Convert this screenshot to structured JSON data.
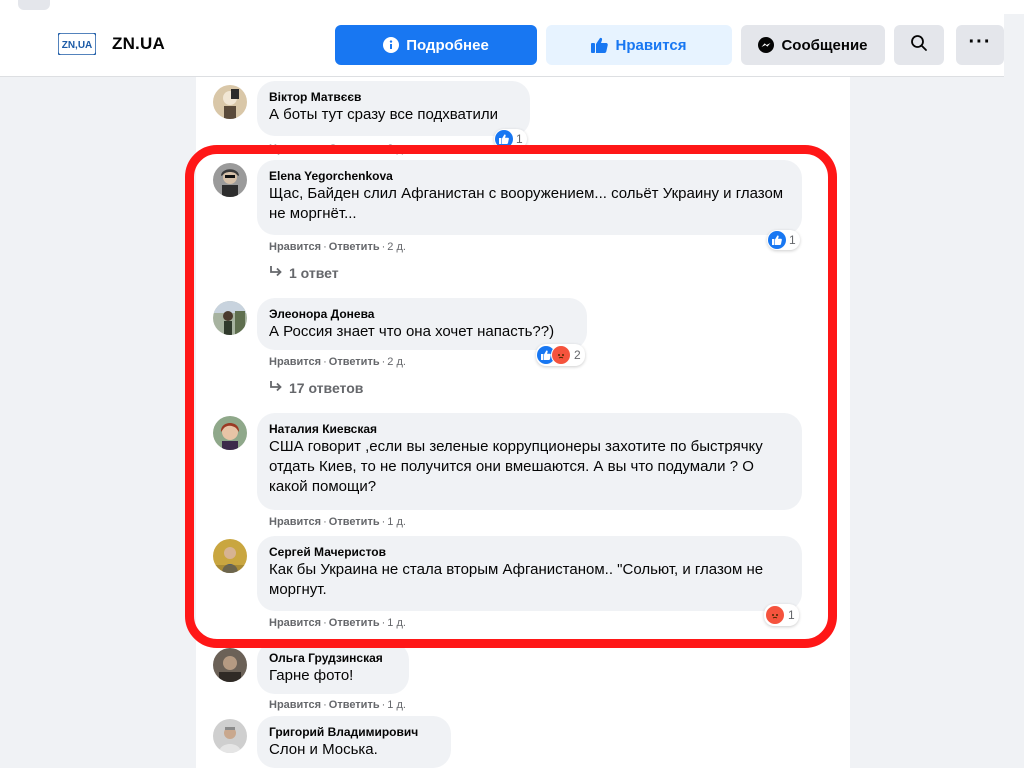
{
  "header": {
    "page_logo_text": "ZN,UA",
    "page_name": "ZN.UA",
    "buttons": {
      "more": "Подробнее",
      "like": "Нравится",
      "message": "Сообщение",
      "dots": "···"
    }
  },
  "comments": [
    {
      "author": "Віктор Матвєєв",
      "text": "А боты тут сразу все подхватили",
      "like_label": "Нравится",
      "reply_label": "Ответить",
      "time": "2 д.",
      "reactions_count": "1"
    },
    {
      "author": "Elena Yegorchenkova",
      "text": "Щас, Байден слил Афганистан с вооружением... сольёт Украину и глазом не моргнёт...",
      "like_label": "Нравится",
      "reply_label": "Ответить",
      "time": "2 д.",
      "reactions_count": "1",
      "replies_label": "1 ответ"
    },
    {
      "author": "Элеонора Донева",
      "text": "А Россия знает что она хочет напасть??)",
      "like_label": "Нравится",
      "reply_label": "Ответить",
      "time": "2 д.",
      "reactions_count": "2",
      "replies_label": "17 ответов"
    },
    {
      "author": "Наталия Киевская",
      "text": "США говорит ,если вы зеленые коррупционеры захотите по быстрячку отдать Киев, то не получится они вмешаются. А вы что подумали ? О какой помощи?",
      "like_label": "Нравится",
      "reply_label": "Ответить",
      "time": "1 д."
    },
    {
      "author": "Сергей Мачеристов",
      "text": "Как бы Украина не стала вторым Афганистаном.. \"Сольют, и глазом не моргнут.",
      "like_label": "Нравится",
      "reply_label": "Ответить",
      "time": "1 д.",
      "reactions_count": "1"
    },
    {
      "author": "Ольга Грудзинская",
      "text": "Гарне фото!",
      "like_label": "Нравится",
      "reply_label": "Ответить",
      "time": "1 д."
    },
    {
      "author": "Григорий Владимирович",
      "text": "Слон и Моська."
    }
  ],
  "colors": {
    "facebook_blue": "#1877f2",
    "highlight_red": "#ff1717",
    "bubble_bg": "#f0f2f5"
  }
}
